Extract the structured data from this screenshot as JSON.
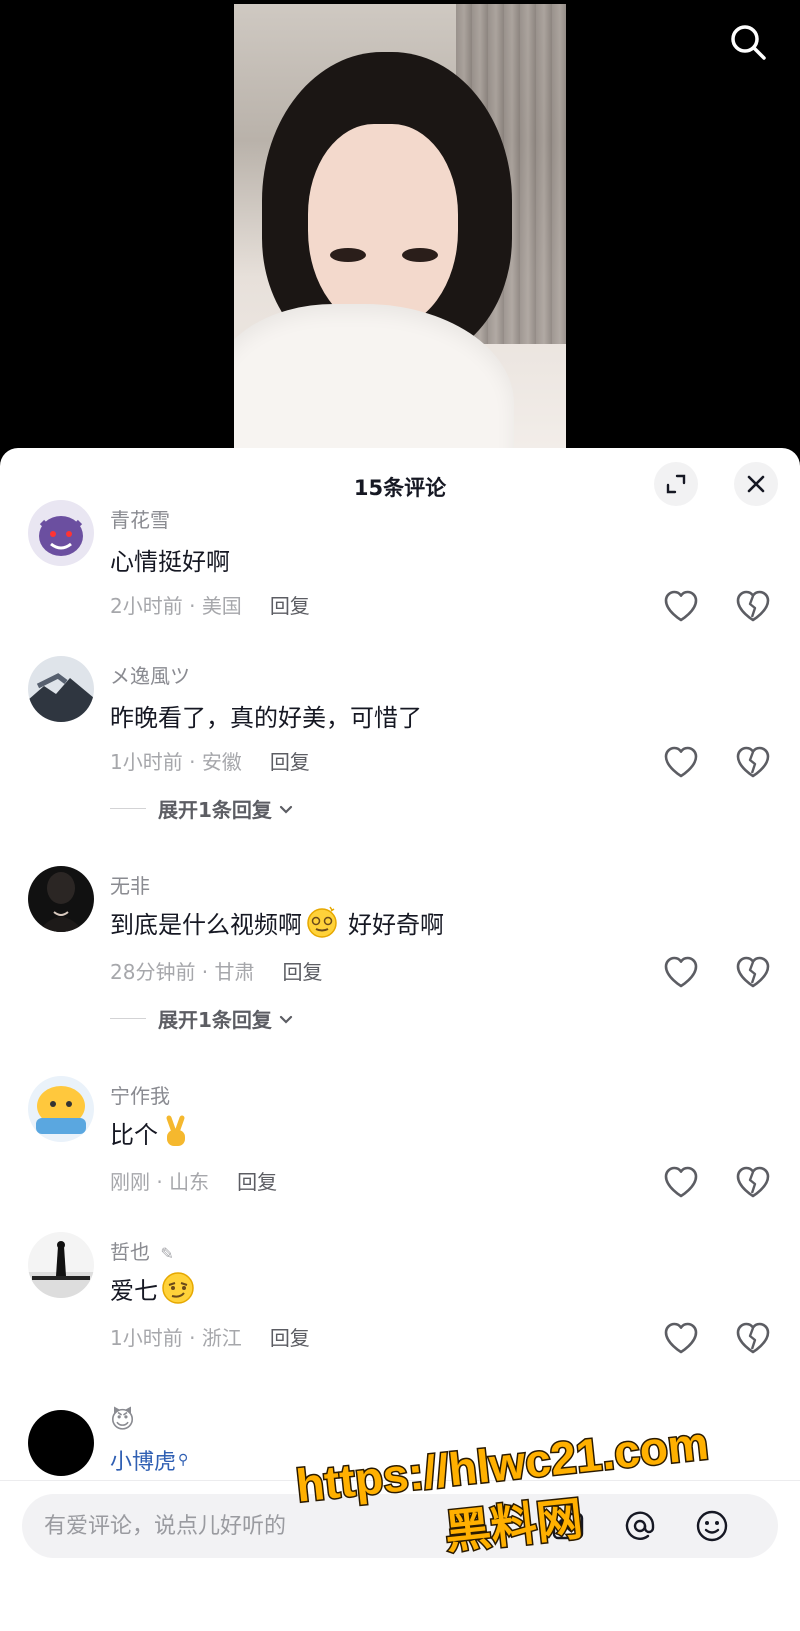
{
  "sheet": {
    "title": "15条评论"
  },
  "comments": [
    {
      "username": "青花雪",
      "text": "心情挺好啊",
      "time": "2小时前",
      "location": "美国",
      "reply": "回复"
    },
    {
      "username": "メ逸風ツ",
      "text": "昨晚看了，真的好美，可惜了",
      "time": "1小时前",
      "location": "安徽",
      "reply": "回复",
      "expand": "展开1条回复"
    },
    {
      "username": "无非",
      "text_before": "到底是什么视频啊",
      "text_after": "好好奇啊",
      "time": "28分钟前",
      "location": "甘肃",
      "reply": "回复",
      "expand": "展开1条回复"
    },
    {
      "username": "宁作我",
      "text": "比个",
      "time": "刚刚",
      "location": "山东",
      "reply": "回复"
    },
    {
      "username": "哲也",
      "text": "爱七",
      "time": "1小时前",
      "location": "浙江",
      "reply": "回复"
    },
    {
      "username_emoji": "😈",
      "name2": "小博虎"
    }
  ],
  "input": {
    "placeholder": "有爱评论，说点儿好听的"
  },
  "watermark": {
    "line1": "https://hlwc21.com",
    "line2": "黑料网"
  },
  "icons": [
    "search-icon",
    "expand-icon",
    "close-icon",
    "heart-icon",
    "broken-heart-icon",
    "image-icon",
    "at-icon",
    "emoji-icon"
  ]
}
